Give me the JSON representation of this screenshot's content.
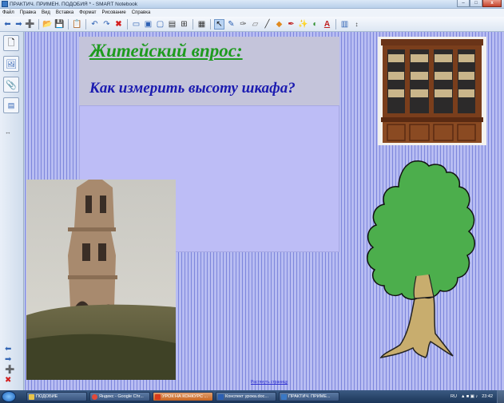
{
  "window": {
    "title": "ПРАКТИЧ. ПРИМЕН. ПОДОБИЯ * - SMART Notebook",
    "buttons": [
      "–",
      "□",
      "x"
    ]
  },
  "menu": [
    "Файл",
    "Правка",
    "Вид",
    "Вставка",
    "Формат",
    "Рисование",
    "Справка"
  ],
  "toolbar": {
    "icons": [
      "back-icon",
      "forward-icon",
      "add-page-icon",
      "open-icon",
      "save-icon",
      "paste-icon",
      "undo-icon",
      "redo-icon",
      "delete-icon",
      "screen-shade-icon",
      "show-display-icon",
      "full-screen-icon",
      "screen-capture-icon",
      "table-icon",
      "select-icon",
      "pen-icon",
      "creative-pen-icon",
      "eraser-icon",
      "line-icon",
      "shapes-icon",
      "fill-icon",
      "magic-pen-icon",
      "properties-icon",
      "text-icon",
      "toolbar-toggle-icon",
      "more-icon"
    ]
  },
  "side_tabs": [
    "page-sorter-icon",
    "gallery-icon",
    "attachments-icon",
    "properties-tab-icon"
  ],
  "slide": {
    "heading": "Житейский впрос:",
    "question": "Как измерить высоту шкафа?",
    "page_link": "Растянуть страницу",
    "colors": {
      "heading": "#1e9b1e",
      "question": "#1b1bb0",
      "background": "#b8bdf2"
    }
  },
  "taskbar": {
    "tasks": [
      {
        "label": "ПОДОБИЕ",
        "icon_color": "#e8c44a",
        "active": false
      },
      {
        "label": "Яндекс - Google Chr...",
        "icon_color": "#e24a3a",
        "active": false
      },
      {
        "label": "УРОК НА КОНКУРС ...",
        "icon_color": "#d83a1a",
        "active": true
      },
      {
        "label": "Конспект урока.doc...",
        "icon_color": "#2b5fb3",
        "active": false
      },
      {
        "label": "ПРАКТИЧ. ПРИМЕ...",
        "icon_color": "#3a78c4",
        "active": false
      }
    ],
    "lang": "RU",
    "time": "23:42"
  }
}
